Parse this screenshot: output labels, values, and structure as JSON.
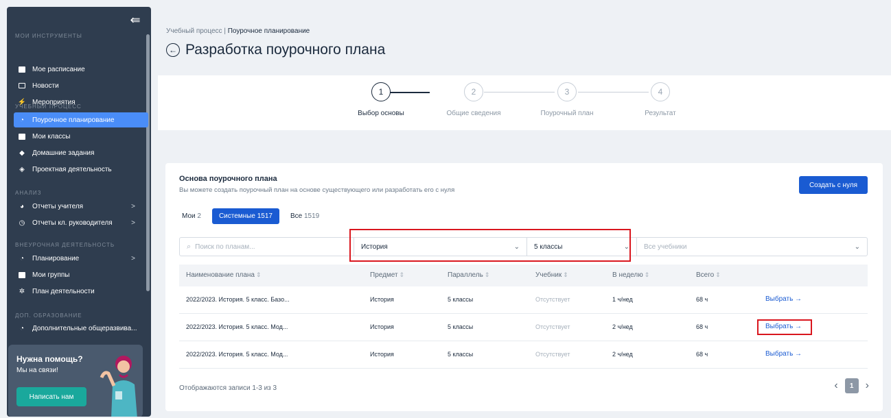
{
  "sidebar": {
    "sections": [
      {
        "title": "МОИ ИНСТРУМЕНТЫ",
        "items": [
          {
            "label": "Мое расписание",
            "icon": "calendar-icon"
          },
          {
            "label": "Новости",
            "icon": "news-icon"
          },
          {
            "label": "Мероприятия",
            "icon": "lightning-icon"
          }
        ]
      },
      {
        "title": "УЧЕБНЫЙ ПРОЦЕСС",
        "items": [
          {
            "label": "Поурочное планирование",
            "icon": "clock-icon",
            "active": true
          },
          {
            "label": "Мои классы",
            "icon": "folder-icon"
          },
          {
            "label": "Домашние задания",
            "icon": "graduation-cap-icon"
          },
          {
            "label": "Проектная деятельность",
            "icon": "box-icon"
          }
        ]
      },
      {
        "title": "АНАЛИЗ",
        "items": [
          {
            "label": "Отчеты учителя",
            "icon": "pie-chart-icon"
          },
          {
            "label": "Отчеты кл. руководителя",
            "icon": "history-icon"
          }
        ]
      },
      {
        "title": "ВНЕУРОЧНАЯ ДЕЯТЕЛЬНОСТЬ",
        "items": [
          {
            "label": "Планирование",
            "icon": "clock-icon"
          },
          {
            "label": "Мои группы",
            "icon": "folder-icon"
          },
          {
            "label": "План деятельности",
            "icon": "sun-icon"
          }
        ]
      },
      {
        "title": "ДОП. ОБРАЗОВАНИЕ",
        "items": [
          {
            "label": "Дополнительные общеразвива...",
            "icon": "clock-icon"
          }
        ]
      }
    ],
    "help": {
      "title": "Нужна помощь?",
      "subtitle": "Мы на связи!",
      "button": "Написать нам"
    }
  },
  "header": {
    "breadcrumb_parent": "Учебный процесс",
    "breadcrumb_sep": "|",
    "breadcrumb_current": "Поурочное планирование",
    "title": "Разработка поурочного плана"
  },
  "stepper": [
    {
      "num": "1",
      "label": "Выбор основы",
      "active": true
    },
    {
      "num": "2",
      "label": "Общие сведения"
    },
    {
      "num": "3",
      "label": "Поурочный план"
    },
    {
      "num": "4",
      "label": "Результат"
    }
  ],
  "card": {
    "title": "Основа поурочного плана",
    "subtitle": "Вы можете создать поурочный план на основе существующего или разработать его с нуля",
    "create_button": "Создать с нуля",
    "tabs": [
      {
        "label": "Мои",
        "count": "2"
      },
      {
        "label": "Системные",
        "count": "1517",
        "active": true
      },
      {
        "label": "Все",
        "count": "1519"
      }
    ],
    "filters": {
      "search_placeholder": "Поиск по планам...",
      "subject": "История",
      "grade": "5 классы",
      "textbook_placeholder": "Все учебники"
    },
    "columns": [
      "Наименование плана",
      "Предмет",
      "Параллель",
      "Учебник",
      "В неделю",
      "Всего"
    ],
    "rows": [
      {
        "name": "2022/2023. История. 5 класс. Базо...",
        "subject": "История",
        "grade": "5 классы",
        "textbook": "Отсутствует",
        "per_week": "1 ч/нед",
        "total": "68 ч",
        "action": "Выбрать →"
      },
      {
        "name": "2022/2023. История. 5 класс. Мод...",
        "subject": "История",
        "grade": "5 классы",
        "textbook": "Отсутствует",
        "per_week": "2 ч/нед",
        "total": "68 ч",
        "action": "Выбрать →"
      },
      {
        "name": "2022/2023. История. 5 класс. Мод...",
        "subject": "История",
        "grade": "5 классы",
        "textbook": "Отсутствует",
        "per_week": "2 ч/нед",
        "total": "68 ч",
        "action": "Выбрать →"
      }
    ],
    "footer_text": "Отображаются записи 1-3 из 3",
    "current_page": "1"
  },
  "colors": {
    "accent": "#1a5bd2",
    "sidebar": "#2f3d4f",
    "highlight": "#d9161e",
    "active_nav": "#4a8df8"
  }
}
